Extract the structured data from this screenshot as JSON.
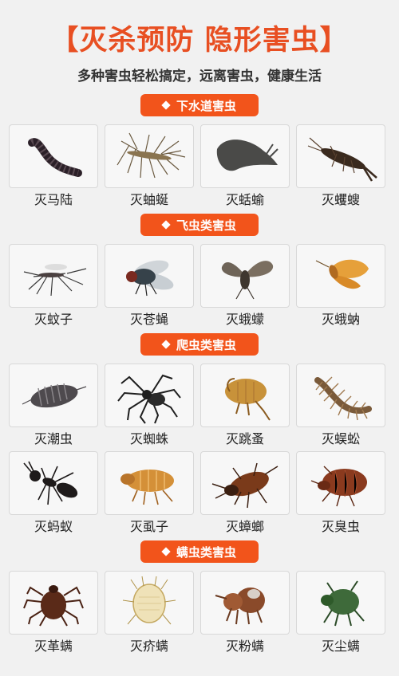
{
  "header": {
    "title": "【灭杀预防 隐形害虫】",
    "subtitle": "多种害虫轻松搞定，远离害虫，健康生活"
  },
  "accent_color": "#f2541b",
  "sections": [
    {
      "title": "下水道害虫",
      "items": [
        {
          "label": "灭马陆",
          "icon": "millipede-icon"
        },
        {
          "label": "灭蚰蜒",
          "icon": "house-centipede-icon"
        },
        {
          "label": "灭蛞蝓",
          "icon": "slug-icon"
        },
        {
          "label": "灭蠼螋",
          "icon": "earwig-icon"
        }
      ]
    },
    {
      "title": "飞虫类害虫",
      "items": [
        {
          "label": "灭蚊子",
          "icon": "mosquito-icon"
        },
        {
          "label": "灭苍蝇",
          "icon": "housefly-icon"
        },
        {
          "label": "灭蛾蠓",
          "icon": "moth-fly-icon"
        },
        {
          "label": "灭蛾蚋",
          "icon": "moth-icon"
        }
      ]
    },
    {
      "title": "爬虫类害虫",
      "items": [
        {
          "label": "灭潮虫",
          "icon": "woodlouse-icon"
        },
        {
          "label": "灭蜘蛛",
          "icon": "spider-icon"
        },
        {
          "label": "灭跳蚤",
          "icon": "flea-icon"
        },
        {
          "label": "灭蜈蚣",
          "icon": "centipede-icon"
        },
        {
          "label": "灭蚂蚁",
          "icon": "ant-icon"
        },
        {
          "label": "灭虱子",
          "icon": "louse-icon"
        },
        {
          "label": "灭蟑螂",
          "icon": "cockroach-icon"
        },
        {
          "label": "灭臭虫",
          "icon": "bedbug-icon"
        }
      ]
    },
    {
      "title": "螨虫类害虫",
      "items": [
        {
          "label": "灭革螨",
          "icon": "gamasid-mite-icon"
        },
        {
          "label": "灭疥螨",
          "icon": "scabies-mite-icon"
        },
        {
          "label": "灭粉螨",
          "icon": "flour-mite-icon"
        },
        {
          "label": "灭尘螨",
          "icon": "dust-mite-icon"
        }
      ]
    }
  ]
}
